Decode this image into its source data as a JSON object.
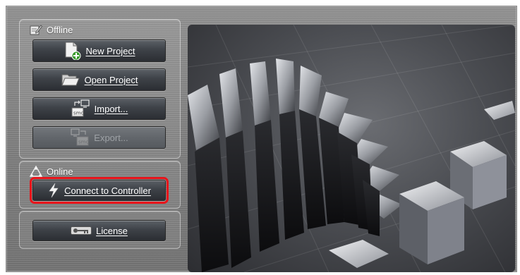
{
  "offline": {
    "title": "Offline",
    "buttons": {
      "new_project": "New Project",
      "open_project": "Open Project",
      "import": "Import...",
      "export": "Export..."
    }
  },
  "online": {
    "title": "Online",
    "buttons": {
      "connect": "Connect to Controller"
    }
  },
  "license": {
    "button": "License"
  },
  "colors": {
    "highlight": "#e8141a",
    "button_top": "#5b6066",
    "button_bottom": "#2b2e33",
    "panel": "#7f7f7f"
  },
  "icons": {
    "offline": "edit-note-icon",
    "new_project": "new-document-icon",
    "open_project": "open-folder-icon",
    "import": "import-icon",
    "export": "export-icon",
    "online": "network-triangle-icon",
    "connect": "lightning-icon",
    "license": "key-icon"
  }
}
